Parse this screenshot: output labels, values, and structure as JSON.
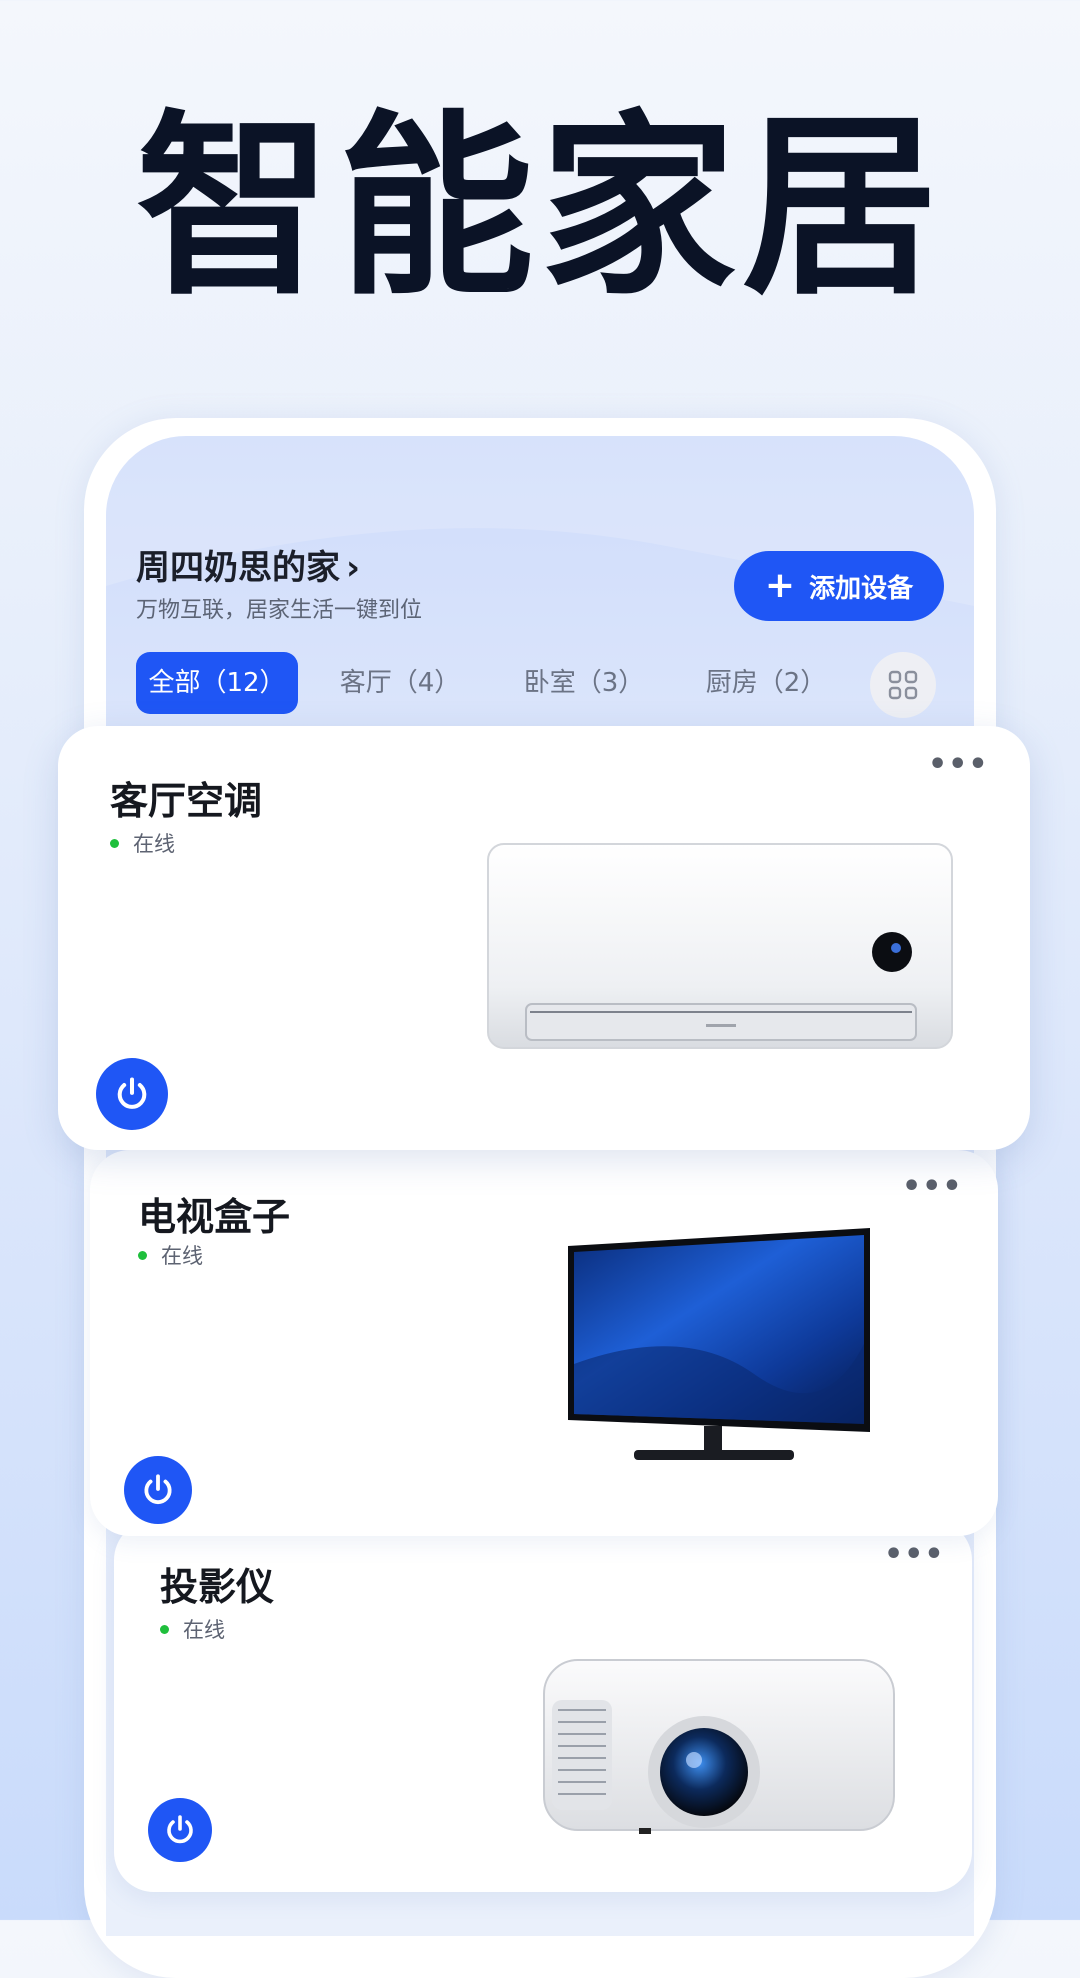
{
  "hero": {
    "title": "智能家居"
  },
  "home": {
    "name": "周四奶思的家",
    "chevron": "›",
    "subtitle": "万物互联，居家生活一键到位",
    "add_button": "添加设备",
    "add_icon": "+"
  },
  "tabs": [
    {
      "label": "全部（12）",
      "active": true
    },
    {
      "label": "客厅（4）",
      "active": false
    },
    {
      "label": "卧室（3）",
      "active": false
    },
    {
      "label": "厨房（2）",
      "active": false
    }
  ],
  "devices": [
    {
      "name": "客厅空调",
      "status": "在线",
      "more": "•••",
      "icon": "air-conditioner"
    },
    {
      "name": "电视盒子",
      "status": "在线",
      "more": "•••",
      "icon": "tv"
    },
    {
      "name": "投影仪",
      "status": "在线",
      "more": "•••",
      "icon": "projector"
    }
  ],
  "colors": {
    "accent": "#1f56f5",
    "online": "#1fbf3c",
    "title": "#0b1326"
  }
}
